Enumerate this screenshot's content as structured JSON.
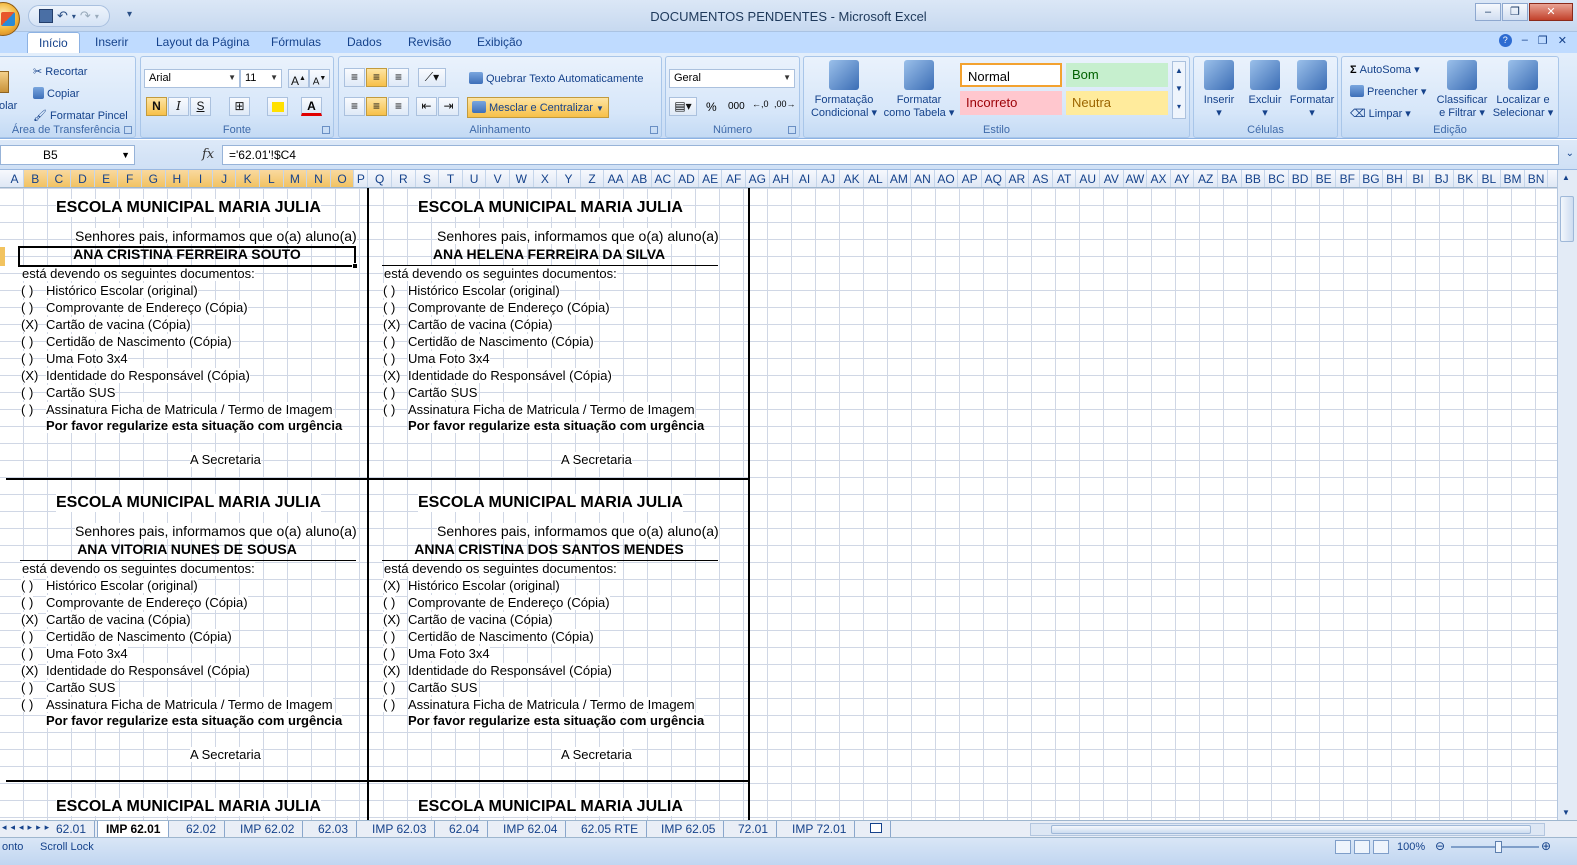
{
  "window": {
    "title": "DOCUMENTOS PENDENTES - Microsoft Excel",
    "controls": {
      "minimize": "–",
      "restore": "❐",
      "close": "✕"
    }
  },
  "ribbon_tabs": [
    "Início",
    "Inserir",
    "Layout da Página",
    "Fórmulas",
    "Dados",
    "Revisão",
    "Exibição"
  ],
  "clipboard": {
    "paste": "olar",
    "cut": "Recortar",
    "copy": "Copiar",
    "painter": "Formatar Pincel",
    "label": "Área de Transferência"
  },
  "font": {
    "name": "Arial",
    "size": "11",
    "bold": "N",
    "italic": "I",
    "underline": "S",
    "label": "Fonte"
  },
  "alignment": {
    "wrap": "Quebrar Texto Automaticamente",
    "merge": "Mesclar e Centralizar",
    "label": "Alinhamento"
  },
  "number": {
    "format": "Geral",
    "percent": "%",
    "thousands": "000",
    "label": "Número"
  },
  "styles": {
    "cond_format_1": "Formatação",
    "cond_format_2": "Condicional",
    "table_format_1": "Formatar",
    "table_format_2": "como Tabela",
    "normal": "Normal",
    "bom": "Bom",
    "incorreto": "Incorreto",
    "neutra": "Neutra",
    "label": "Estilo",
    "colors": {
      "normal_border": "#f3a230",
      "bom_bg": "#c6efce",
      "bom_fg": "#006100",
      "incorreto_bg": "#ffc7ce",
      "incorreto_fg": "#9c0006",
      "neutra_bg": "#ffeb9c",
      "neutra_fg": "#9c6500"
    }
  },
  "cells": {
    "insert": "Inserir",
    "delete": "Excluir",
    "format": "Formatar",
    "label": "Células"
  },
  "editing": {
    "autosum": "AutoSoma",
    "fill": "Preencher",
    "clear": "Limpar",
    "sort_1": "Classificar",
    "sort_2": "e Filtrar",
    "find_1": "Localizar e",
    "find_2": "Selecionar",
    "label": "Edição"
  },
  "formula_bar": {
    "name_box": "B5",
    "fx": "fx",
    "formula": "='62.01'!$C4"
  },
  "columns": [
    "A",
    "B",
    "C",
    "D",
    "E",
    "F",
    "G",
    "H",
    "I",
    "J",
    "K",
    "L",
    "M",
    "N",
    "O",
    "P",
    "Q",
    "R",
    "S",
    "T",
    "U",
    "V",
    "W",
    "X",
    "Y",
    "Z",
    "AA",
    "AB",
    "AC",
    "AD",
    "AE",
    "AF",
    "AG",
    "AH",
    "AI",
    "AJ",
    "AK",
    "AL",
    "AM",
    "AN",
    "AO",
    "AP",
    "AQ",
    "AR",
    "AS",
    "AT",
    "AU",
    "AV",
    "AW",
    "AX",
    "AY",
    "AZ",
    "BA",
    "BB",
    "BC",
    "BD",
    "BE",
    "BF",
    "BG",
    "BH",
    "BI",
    "BJ",
    "BK",
    "BL",
    "BM",
    "BN"
  ],
  "highlight_columns": [
    "B",
    "C",
    "D",
    "E",
    "F",
    "G",
    "H",
    "I",
    "J",
    "K",
    "L",
    "M",
    "N",
    "O"
  ],
  "form": {
    "school": "ESCOLA MUNICIPAL MARIA JULIA",
    "greeting": "Senhores pais, informamos que o(a) aluno(a)",
    "owing": "está devendo os seguintes documentos:",
    "items": [
      "Histórico Escolar (original)",
      "Comprovante de Endereço (Cópia)",
      "Cartão de vacina (Cópia)",
      "Certidão de Nascimento (Cópia)",
      "Uma Foto 3x4",
      "Identidade do Responsável (Cópia)",
      "Cartão SUS",
      "Assinatura Ficha de Matricula / Termo de Imagem"
    ],
    "urgency": "Por favor regularize esta situação com urgência",
    "signature": "A Secretaria"
  },
  "blocks": [
    {
      "student": "ANA CRISTINA FERREIRA SOUTO",
      "marks": [
        "( )",
        "( )",
        "(X)",
        "( )",
        "( )",
        "(X)",
        "( )",
        "( )"
      ]
    },
    {
      "student": "ANA HELENA FERREIRA DA SILVA",
      "marks": [
        "( )",
        "( )",
        "(X)",
        "( )",
        "( )",
        "(X)",
        "( )",
        "( )"
      ]
    },
    {
      "student": "ANA VITORIA NUNES DE SOUSA",
      "marks": [
        "( )",
        "( )",
        "(X)",
        "( )",
        "( )",
        "(X)",
        "( )",
        "( )"
      ]
    },
    {
      "student": "ANNA CRISTINA DOS SANTOS MENDES",
      "marks": [
        "(X)",
        "( )",
        "(X)",
        "( )",
        "( )",
        "(X)",
        "( )",
        "( )"
      ]
    }
  ],
  "sheet_tabs": [
    "62.01",
    "IMP 62.01",
    "62.02",
    "IMP 62.02",
    "62.03",
    "IMP 62.03",
    "62.04",
    "IMP 62.04",
    "62.05 RTE",
    "IMP 62.05",
    "72.01",
    "IMP 72.01"
  ],
  "active_sheet": "IMP 62.01",
  "status": {
    "left1": "onto",
    "left2": "Scroll Lock",
    "zoom": "100%"
  }
}
